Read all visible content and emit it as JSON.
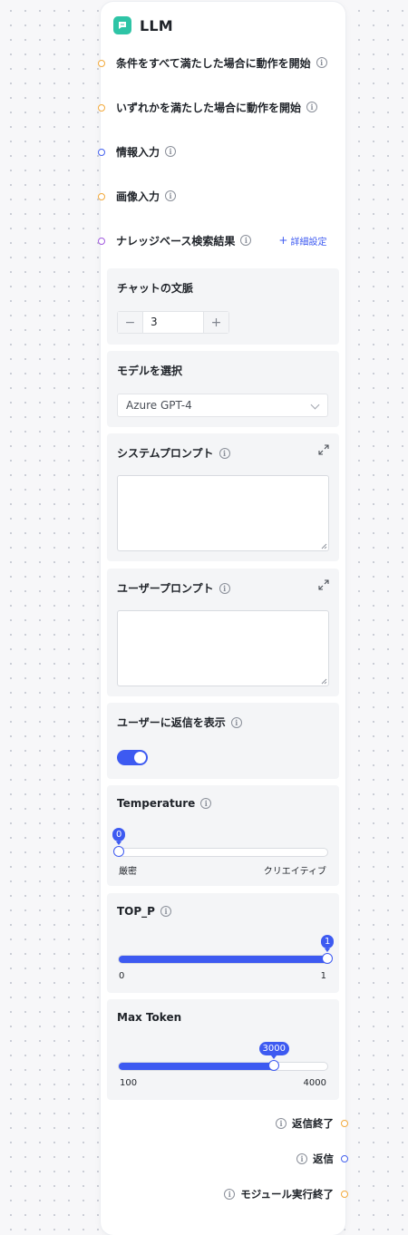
{
  "node": {
    "title": "LLM",
    "icon": "chat-bubble-icon"
  },
  "inputs": [
    {
      "label": "条件をすべて満たした場合に動作を開始",
      "port_color": "#f2a93b"
    },
    {
      "label": "いずれかを満たした場合に動作を開始",
      "port_color": "#f2a93b"
    },
    {
      "label": "情報入力",
      "port_color": "#4461ee"
    },
    {
      "label": "画像入力",
      "port_color": "#f2a93b"
    },
    {
      "label": "ナレッジベース検索結果",
      "port_color": "#a25ae0",
      "link": "詳細設定"
    }
  ],
  "chat_context": {
    "label": "チャットの文脈",
    "value": "3",
    "minus": "−",
    "plus": "+"
  },
  "model": {
    "label": "モデルを選択",
    "selected": "Azure GPT-4"
  },
  "system_prompt": {
    "label": "システムプロンプト",
    "value": ""
  },
  "user_prompt": {
    "label": "ユーザープロンプト",
    "value": ""
  },
  "show_reply": {
    "label": "ユーザーに返信を表示",
    "enabled": true
  },
  "temperature": {
    "label": "Temperature",
    "value": "0",
    "fraction": 0.0,
    "min_label": "厳密",
    "max_label": "クリエイティブ"
  },
  "top_p": {
    "label": "TOP_P",
    "value": "1",
    "fraction": 1.0,
    "min_label": "0",
    "max_label": "1"
  },
  "max_token": {
    "label": "Max Token",
    "value": "3000",
    "fraction": 0.7436,
    "min_label": "100",
    "max_label": "4000"
  },
  "outputs": [
    {
      "label": "返信終了",
      "port_color": "#f2a93b"
    },
    {
      "label": "返信",
      "port_color": "#4461ee"
    },
    {
      "label": "モジュール実行終了",
      "port_color": "#f2a93b"
    }
  ],
  "colors": {
    "accent": "#3d5af1",
    "node_icon": "#2ec4a6"
  }
}
